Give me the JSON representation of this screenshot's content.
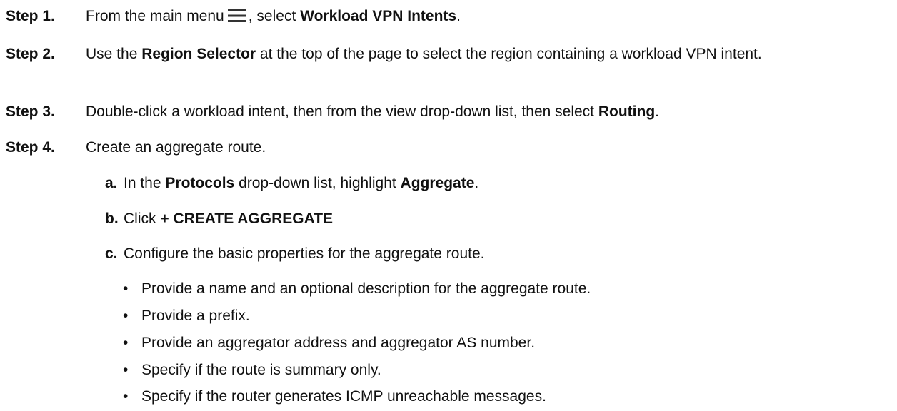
{
  "steps": [
    {
      "label": "Step 1.",
      "parts": [
        "From the main menu",
        ", select ",
        "Workload VPN Intents",
        "."
      ]
    },
    {
      "label": "Step 2.",
      "parts": [
        "Use the ",
        "Region Selector",
        " at the top of the page to select the region containing a workload VPN intent."
      ]
    },
    {
      "label": "Step 3.",
      "parts": [
        "Double-click a workload intent, then from the view drop-down list, then select ",
        "Routing",
        "."
      ]
    },
    {
      "label": "Step 4.",
      "parts": [
        "Create an aggregate route."
      ]
    }
  ],
  "substeps": [
    {
      "label": "a.",
      "parts": [
        "In the ",
        "Protocols",
        " drop-down list, highlight ",
        "Aggregate",
        "."
      ]
    },
    {
      "label": "b.",
      "parts": [
        "Click ",
        "+ CREATE AGGREGATE"
      ]
    },
    {
      "label": "c.",
      "parts": [
        "Configure the basic properties for the aggregate route."
      ]
    }
  ],
  "bullets": [
    "Provide a name and an optional description for the aggregate route.",
    "Provide a prefix.",
    "Provide an aggregator address and aggregator AS number.",
    "Specify if the route is summary only.",
    "Specify if the router generates ICMP unreachable messages."
  ],
  "bullet_char": "•",
  "icons": {
    "main_menu": "hamburger-menu-icon"
  }
}
